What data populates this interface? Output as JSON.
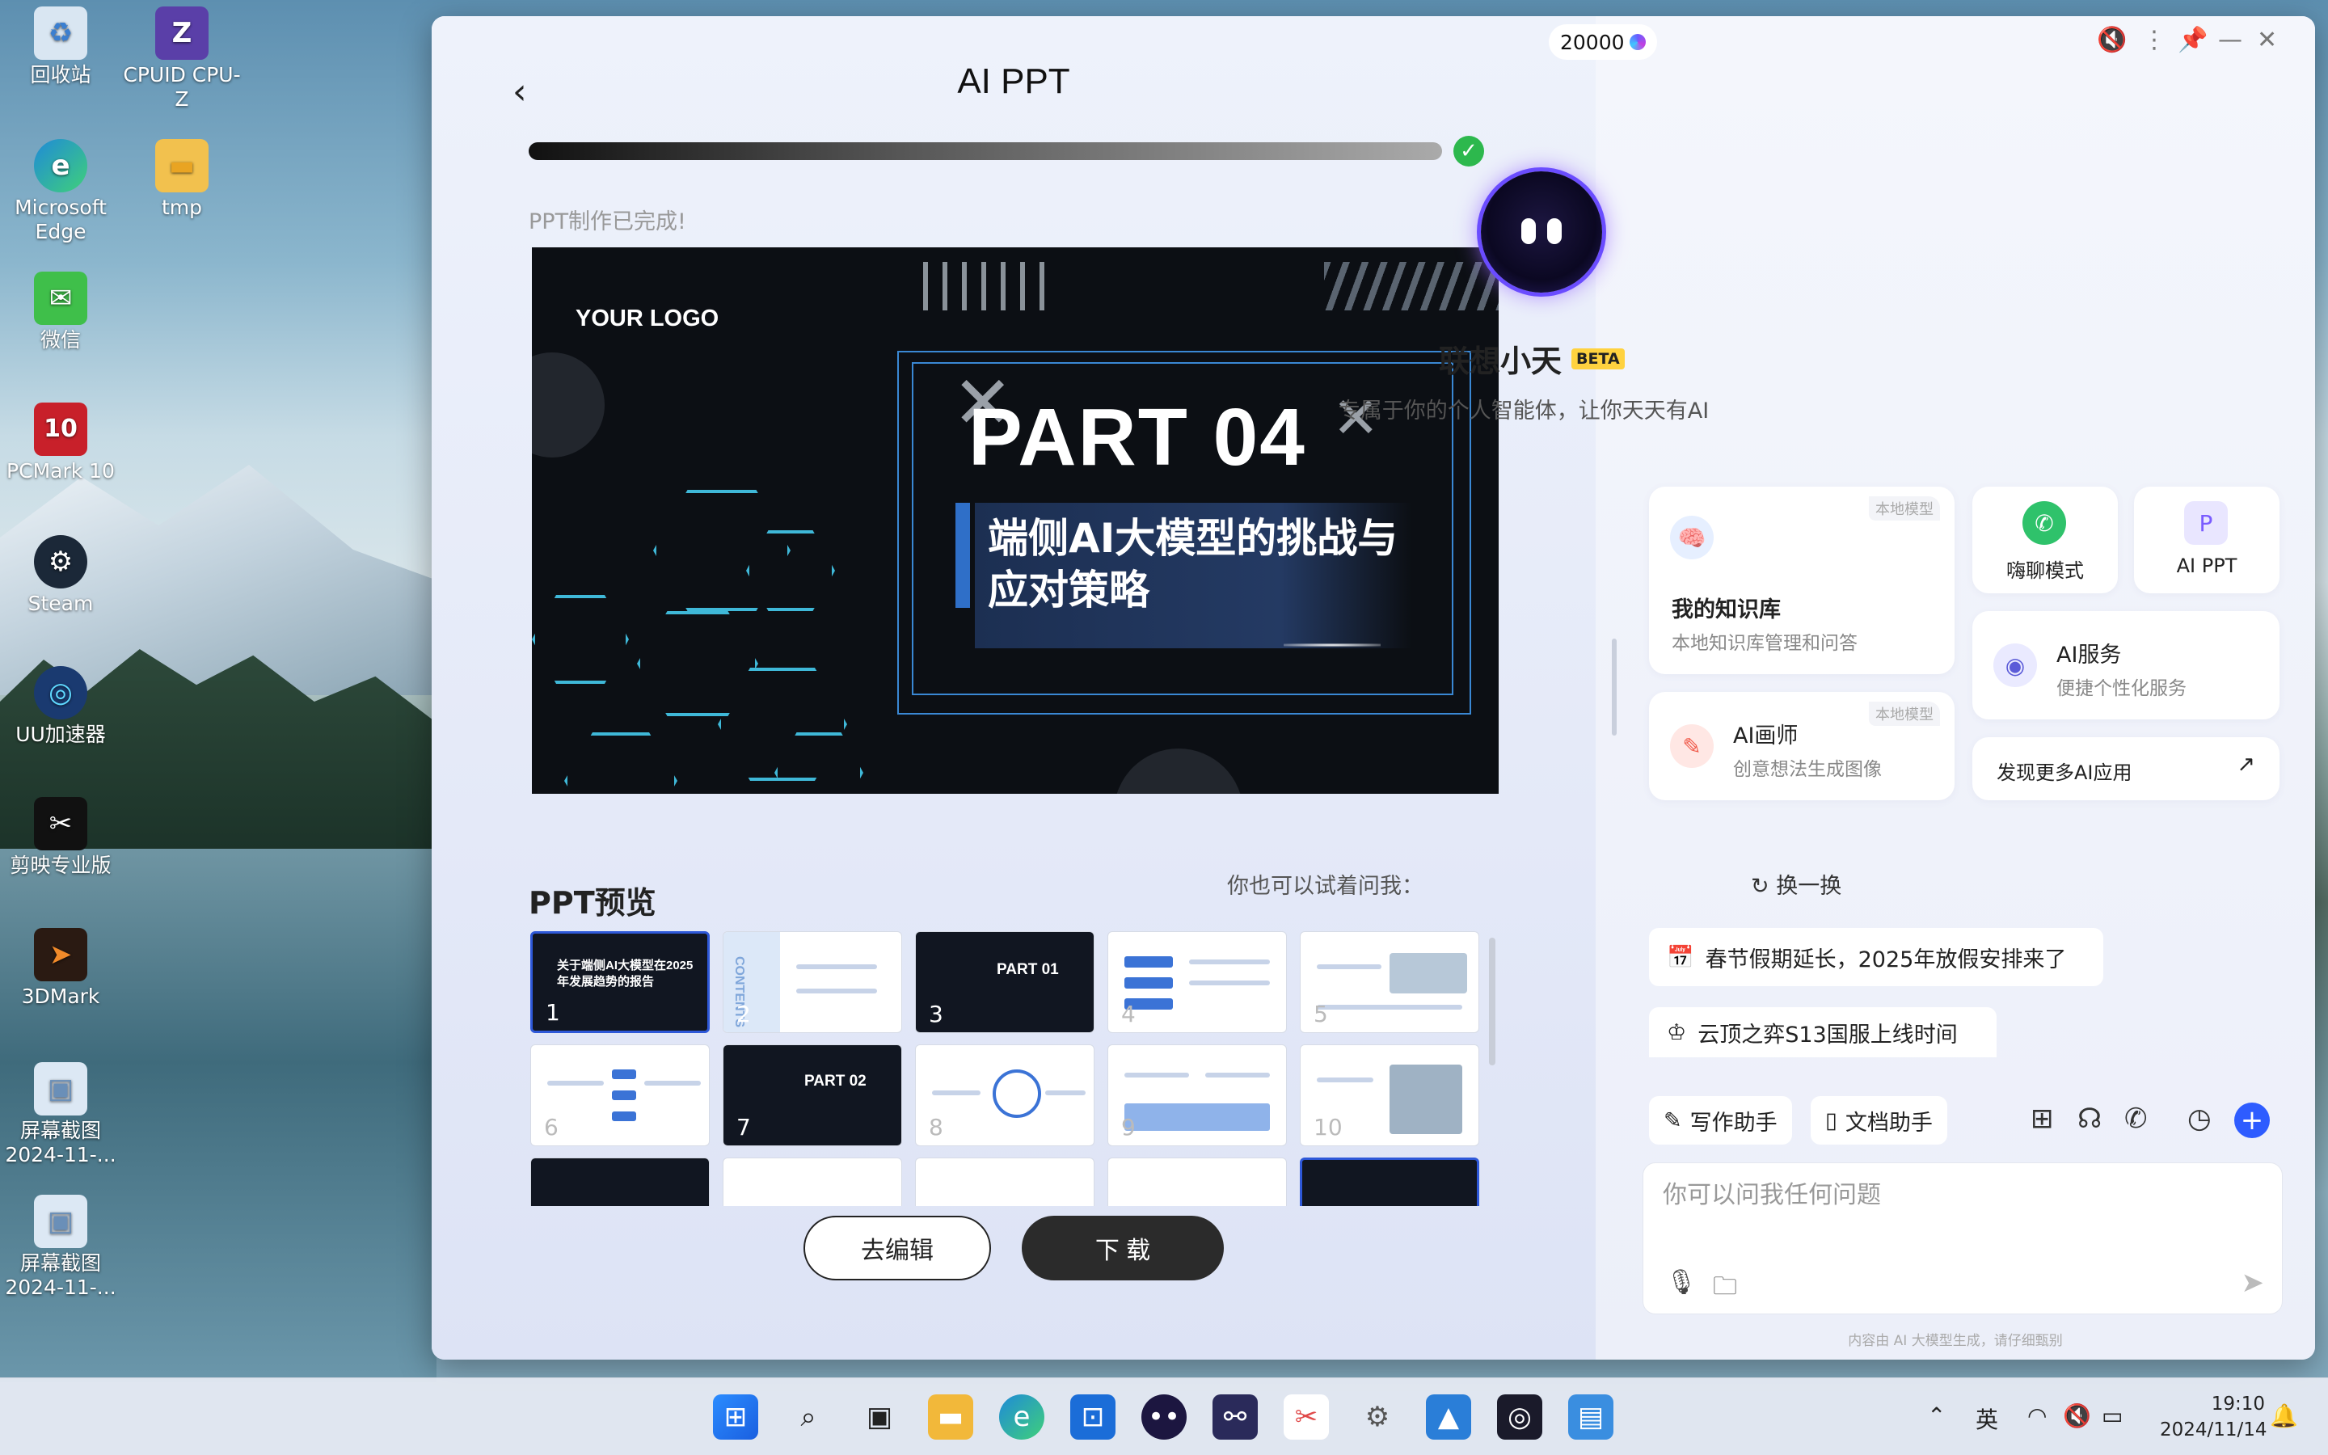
{
  "desktop": {
    "icons": [
      {
        "label": "回收站",
        "glyph": "♻",
        "color": "#d9e6f2"
      },
      {
        "label": "CPUID CPU-Z",
        "glyph": "Z",
        "color": "#5a3fa8"
      },
      {
        "label": "Microsoft Edge",
        "glyph": "e",
        "color": "#1f8ad8"
      },
      {
        "label": "tmp",
        "glyph": "▬",
        "color": "#f2c14e"
      },
      {
        "label": "微信",
        "glyph": "✉",
        "color": "#3fbf4a"
      },
      {
        "label": "PCMark 10",
        "glyph": "10",
        "color": "#c8202a"
      },
      {
        "label": "Steam",
        "glyph": "⚙",
        "color": "#1b2838"
      },
      {
        "label": "UU加速器",
        "glyph": "◎",
        "color": "#1a3a70"
      },
      {
        "label": "剪映专业版",
        "glyph": "✂",
        "color": "#111111"
      },
      {
        "label": "3DMark",
        "glyph": "➤",
        "color": "#2a1a12"
      },
      {
        "label": "屏幕截图 2024-11-...",
        "glyph": "▣",
        "color": "#a9c6e6"
      },
      {
        "label": "屏幕截图 2024-11-...",
        "glyph": "▣",
        "color": "#a9c6e6"
      }
    ]
  },
  "app": {
    "title": "AI PPT",
    "progress": 1.0,
    "status": "PPT制作已完成!",
    "slide": {
      "logo": "YOUR LOGO",
      "part": "PART 04",
      "subtitle_line1": "端侧AI大模型的挑战与",
      "subtitle_line2": "应对策略"
    },
    "preview_title": "PPT预览",
    "thumbnails": [
      {
        "n": "1",
        "theme": "dark",
        "text": "关于端侧AI大模型在2025年发展趋势的报告"
      },
      {
        "n": "2",
        "theme": "light",
        "text": "CONTENTS"
      },
      {
        "n": "3",
        "theme": "dark",
        "text": "PART 01"
      },
      {
        "n": "4",
        "theme": "light",
        "text": ""
      },
      {
        "n": "5",
        "theme": "light",
        "text": ""
      },
      {
        "n": "6",
        "theme": "light",
        "text": ""
      },
      {
        "n": "7",
        "theme": "dark",
        "text": "PART 02"
      },
      {
        "n": "8",
        "theme": "light",
        "text": ""
      },
      {
        "n": "9",
        "theme": "light",
        "text": ""
      },
      {
        "n": "10",
        "theme": "light",
        "text": ""
      }
    ],
    "edit_label": "去编辑",
    "download_label": "下 载"
  },
  "assistant": {
    "credits": "20000",
    "name": "联想小天",
    "beta": "BETA",
    "tagline": "专属于你的个人智能体，让你天天有AI",
    "cards": {
      "knowledge": {
        "title": "我的知识库",
        "desc": "本地知识库管理和问答",
        "tag": "本地模型"
      },
      "chat": {
        "title": "嗨聊模式"
      },
      "ppt": {
        "title": "AI PPT"
      },
      "service": {
        "title": "AI服务",
        "desc": "便捷个性化服务"
      },
      "painter": {
        "title": "AI画师",
        "desc": "创意想法生成图像",
        "tag": "本地模型"
      },
      "more": {
        "title": "发现更多AI应用"
      }
    },
    "suggest_heading": "你也可以试着问我：",
    "refresh_label": "换一换",
    "suggestions": [
      "春节假期延长，2025年放假安排来了",
      "云顶之弈S13国服上线时间"
    ],
    "tools": {
      "writing": "写作助手",
      "doc": "文档助手"
    },
    "input_placeholder": "你可以问我任何问题",
    "footnote": "内容由 AI 大模型生成，请仔细甄别"
  },
  "taskbar": {
    "ime": "英",
    "time": "19:10",
    "date": "2024/11/14"
  }
}
